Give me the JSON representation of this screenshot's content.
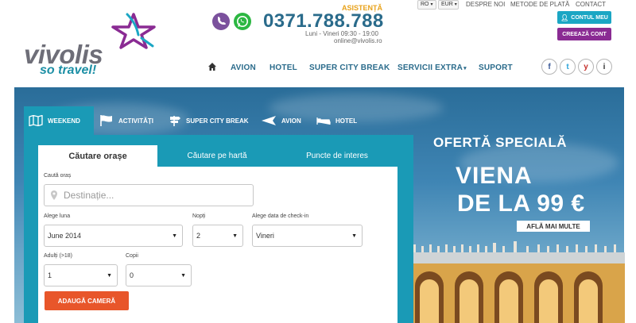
{
  "brand": {
    "name": "vivolis",
    "tagline": "so travel!",
    "colors": {
      "teal": "#1a9ab6",
      "purple": "#8a2b93",
      "orange": "#e8562a",
      "navy": "#2a6b8b"
    }
  },
  "contact": {
    "assist_label": "ASISTENȚĂ",
    "phone": "0371.788.788",
    "hours": "Luni - Vineri 09:30 - 19:00",
    "email": "online@vivolis.ro"
  },
  "topbar": {
    "lang": "RO",
    "currency": "EUR",
    "links": [
      "DESPRE NOI",
      "METODE DE PLATĂ",
      "CONTACT"
    ],
    "account_label": "CONTUL MEU",
    "create_label": "CREEAZĂ CONT"
  },
  "nav": {
    "items": [
      "AVION",
      "HOTEL",
      "SUPER CITY BREAK",
      "SERVICII EXTRA",
      "SUPORT"
    ]
  },
  "social": [
    "f",
    "t",
    "y",
    "i"
  ],
  "search": {
    "tabs": [
      "WEEKEND",
      "ACTIVITĂȚI",
      "SUPER CITY BREAK",
      "AVION",
      "HOTEL"
    ],
    "subtabs": [
      "Căutare orașe",
      "Căutare pe hartă",
      "Puncte de interes"
    ],
    "city_label": "Caută oraș",
    "city_placeholder": "Destinație...",
    "month_label": "Alege luna",
    "month_value": "June 2014",
    "nights_label": "Nopți",
    "nights_value": "2",
    "checkin_label": "Alege data de check-in",
    "checkin_value": "Vineri",
    "adults_label": "Adulți (>18)",
    "adults_value": "1",
    "children_label": "Copii",
    "children_value": "0",
    "add_room_label": "ADAUGĂ CAMERĂ"
  },
  "promo": {
    "title": "OFERTĂ SPECIALĂ",
    "city": "VIENA",
    "price": "DE LA 99 €",
    "cta": "AFLĂ MAI MULTE"
  }
}
